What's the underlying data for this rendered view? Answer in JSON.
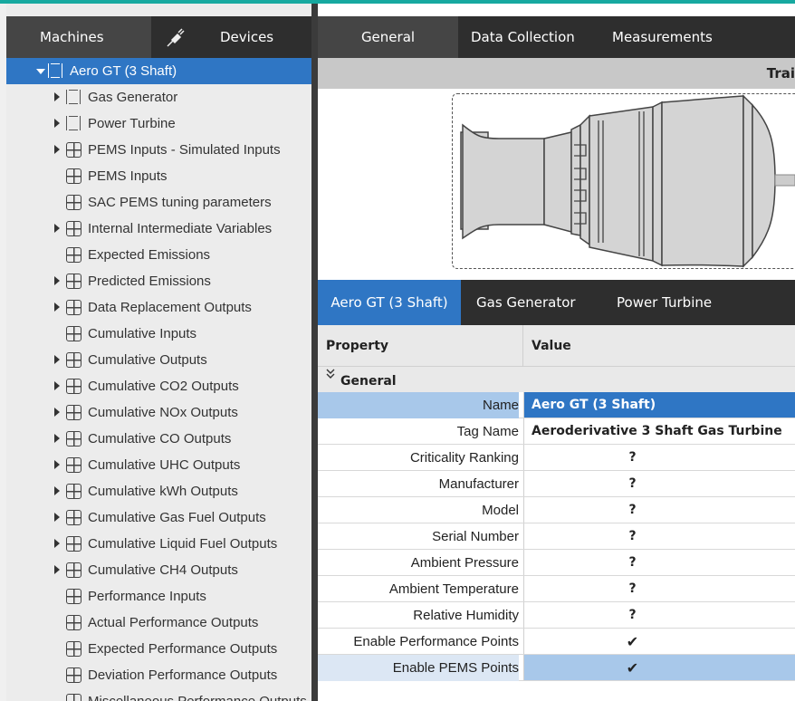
{
  "left_tabs": {
    "machines": "Machines",
    "devices": "Devices",
    "plug_icon": "plug-icon"
  },
  "tree": [
    {
      "label": "Aero GT (3 Shaft)",
      "level": 0,
      "expander": "expanded",
      "icon": "engine-icon",
      "selected": true
    },
    {
      "label": "Gas Generator",
      "level": 1,
      "expander": "collapsed",
      "icon": "engine-icon"
    },
    {
      "label": "Power Turbine",
      "level": 1,
      "expander": "collapsed",
      "icon": "engine-icon"
    },
    {
      "label": "PEMS Inputs - Simulated Inputs",
      "level": 1,
      "expander": "collapsed",
      "icon": "grid-icon"
    },
    {
      "label": "PEMS Inputs",
      "level": 1,
      "expander": "none",
      "icon": "grid-icon"
    },
    {
      "label": "SAC PEMS tuning parameters",
      "level": 1,
      "expander": "none",
      "icon": "grid-icon"
    },
    {
      "label": "Internal Intermediate Variables",
      "level": 1,
      "expander": "collapsed",
      "icon": "grid-icon"
    },
    {
      "label": "Expected Emissions",
      "level": 1,
      "expander": "none",
      "icon": "grid-icon"
    },
    {
      "label": "Predicted Emissions",
      "level": 1,
      "expander": "collapsed",
      "icon": "grid-icon"
    },
    {
      "label": "Data Replacement Outputs",
      "level": 1,
      "expander": "collapsed",
      "icon": "grid-icon"
    },
    {
      "label": "Cumulative Inputs",
      "level": 1,
      "expander": "none",
      "icon": "grid-icon"
    },
    {
      "label": "Cumulative Outputs",
      "level": 1,
      "expander": "collapsed",
      "icon": "grid-icon"
    },
    {
      "label": "Cumulative CO2 Outputs",
      "level": 1,
      "expander": "collapsed",
      "icon": "grid-icon"
    },
    {
      "label": "Cumulative NOx Outputs",
      "level": 1,
      "expander": "collapsed",
      "icon": "grid-icon"
    },
    {
      "label": "Cumulative CO Outputs",
      "level": 1,
      "expander": "collapsed",
      "icon": "grid-icon"
    },
    {
      "label": "Cumulative UHC Outputs",
      "level": 1,
      "expander": "collapsed",
      "icon": "grid-icon"
    },
    {
      "label": "Cumulative kWh Outputs",
      "level": 1,
      "expander": "collapsed",
      "icon": "grid-icon"
    },
    {
      "label": "Cumulative Gas Fuel Outputs",
      "level": 1,
      "expander": "collapsed",
      "icon": "grid-icon"
    },
    {
      "label": "Cumulative Liquid Fuel Outputs",
      "level": 1,
      "expander": "collapsed",
      "icon": "grid-icon"
    },
    {
      "label": "Cumulative CH4 Outputs",
      "level": 1,
      "expander": "collapsed",
      "icon": "grid-icon"
    },
    {
      "label": "Performance Inputs",
      "level": 1,
      "expander": "none",
      "icon": "grid-icon"
    },
    {
      "label": "Actual Performance Outputs",
      "level": 1,
      "expander": "none",
      "icon": "grid-icon"
    },
    {
      "label": "Expected Performance Outputs",
      "level": 1,
      "expander": "none",
      "icon": "grid-icon"
    },
    {
      "label": "Deviation Performance Outputs",
      "level": 1,
      "expander": "none",
      "icon": "grid-icon"
    },
    {
      "label": "Miscellaneous Performance Outputs",
      "level": 1,
      "expander": "none",
      "icon": "grid-icon"
    }
  ],
  "right_tabs": {
    "general": "General",
    "data_collection": "Data Collection",
    "measurements": "Measurements"
  },
  "train_label": "Trai",
  "sub_tabs": {
    "aero": "Aero GT (3 Shaft)",
    "gas_generator": "Gas Generator",
    "power_turbine": "Power Turbine"
  },
  "grid": {
    "header_property": "Property",
    "header_value": "Value",
    "group_label": "General",
    "group_icon": "chevron-double-down-icon",
    "rows": [
      {
        "name": "Name",
        "value": "Aero GT (3 Shaft)",
        "kind": "text",
        "state": "selected"
      },
      {
        "name": "Tag Name",
        "value": "Aeroderivative 3 Shaft Gas Turbine",
        "kind": "text"
      },
      {
        "name": "Criticality Ranking",
        "value": "?",
        "kind": "center"
      },
      {
        "name": "Manufacturer",
        "value": "?",
        "kind": "center"
      },
      {
        "name": "Model",
        "value": "?",
        "kind": "center"
      },
      {
        "name": "Serial Number",
        "value": "?",
        "kind": "center"
      },
      {
        "name": "Ambient Pressure",
        "value": "?",
        "kind": "center"
      },
      {
        "name": "Ambient Temperature",
        "value": "?",
        "kind": "center"
      },
      {
        "name": "Relative Humidity",
        "value": "?",
        "kind": "center"
      },
      {
        "name": "Enable Performance Points",
        "value": "✔",
        "kind": "center"
      },
      {
        "name": "Enable PEMS Points",
        "value": "✔",
        "kind": "center",
        "state": "hover"
      }
    ]
  },
  "colors": {
    "accent": "#2f76c4",
    "tab_bar": "#2e2e2e",
    "top_line": "#17a9a0"
  }
}
